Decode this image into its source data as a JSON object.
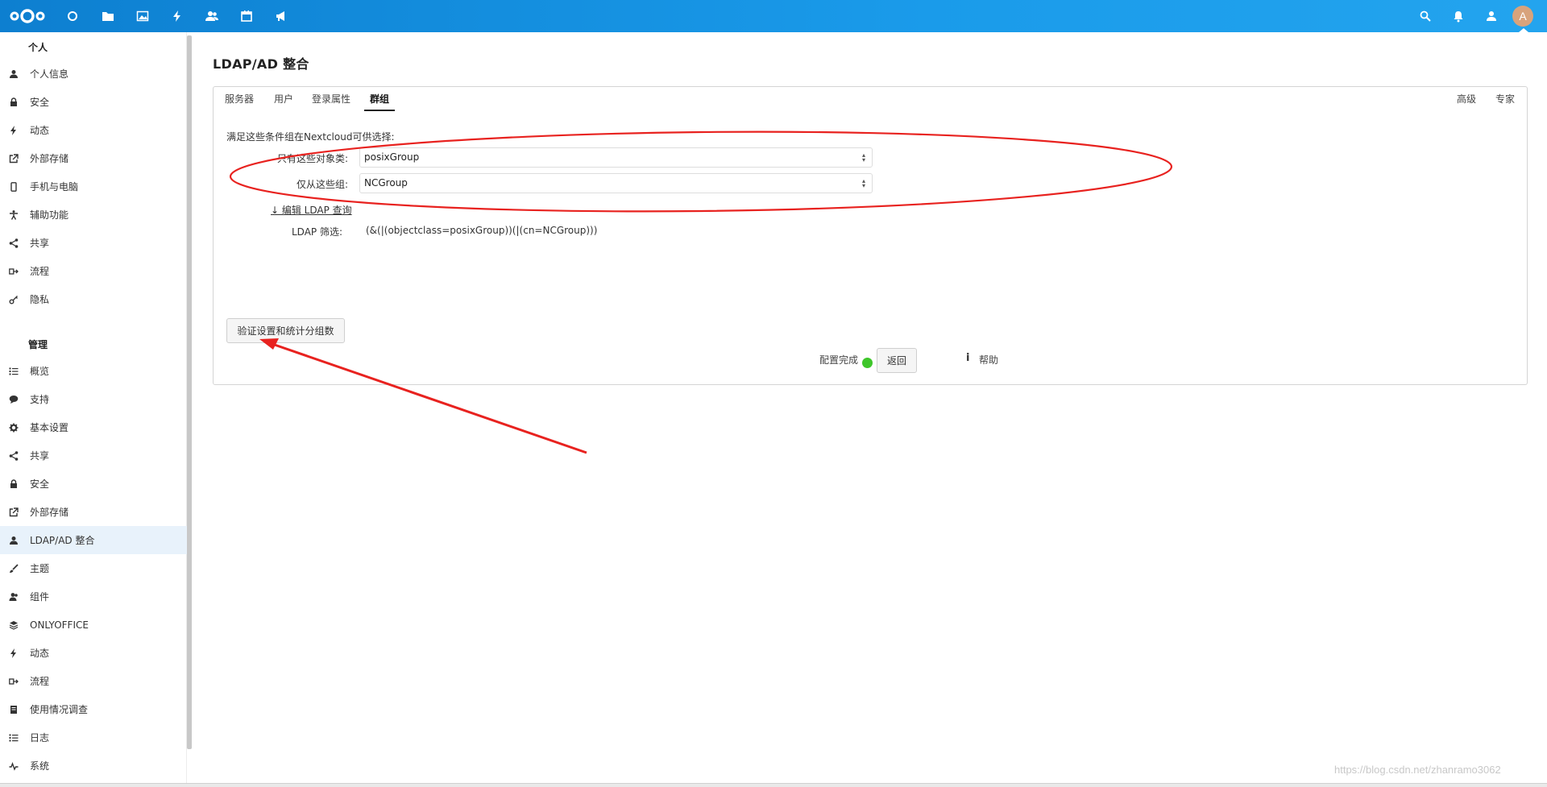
{
  "header": {
    "apps": [
      {
        "name": "dashboard-icon"
      },
      {
        "name": "files-icon"
      },
      {
        "name": "photos-icon"
      },
      {
        "name": "activity-icon"
      },
      {
        "name": "contacts-icon"
      },
      {
        "name": "calendar-icon"
      },
      {
        "name": "announcements-icon"
      }
    ],
    "avatar_letter": "A",
    "accent_color": "#1a8fe0"
  },
  "sidebar": {
    "personal_caption": "个人",
    "personal_items": [
      {
        "label": "个人信息",
        "icon": "user-icon"
      },
      {
        "label": "安全",
        "icon": "lock-icon"
      },
      {
        "label": "动态",
        "icon": "lightning-icon"
      },
      {
        "label": "外部存储",
        "icon": "external-link-icon"
      },
      {
        "label": "手机与电脑",
        "icon": "phone-icon"
      },
      {
        "label": "辅助功能",
        "icon": "accessibility-icon"
      },
      {
        "label": "共享",
        "icon": "share-icon"
      },
      {
        "label": "流程",
        "icon": "flow-icon"
      },
      {
        "label": "隐私",
        "icon": "key-icon"
      }
    ],
    "admin_caption": "管理",
    "admin_items": [
      {
        "label": "概览",
        "icon": "list-icon"
      },
      {
        "label": "支持",
        "icon": "speech-bubble-icon"
      },
      {
        "label": "基本设置",
        "icon": "gear-icon"
      },
      {
        "label": "共享",
        "icon": "share-icon"
      },
      {
        "label": "安全",
        "icon": "lock-icon"
      },
      {
        "label": "外部存储",
        "icon": "external-link-icon"
      },
      {
        "label": "LDAP/AD 整合",
        "icon": "user-icon",
        "active": true
      },
      {
        "label": "主题",
        "icon": "paintbrush-icon"
      },
      {
        "label": "组件",
        "icon": "group-icon"
      },
      {
        "label": "ONLYOFFICE",
        "icon": "layers-icon"
      },
      {
        "label": "动态",
        "icon": "lightning-icon"
      },
      {
        "label": "流程",
        "icon": "flow-icon"
      },
      {
        "label": "使用情况调查",
        "icon": "survey-icon"
      },
      {
        "label": "日志",
        "icon": "list-icon"
      },
      {
        "label": "系统",
        "icon": "pulse-icon"
      }
    ]
  },
  "main": {
    "title": "LDAP/AD 整合",
    "tabs": [
      "服务器",
      "用户",
      "登录属性",
      "群组"
    ],
    "active_tab": "群组",
    "right_tabs": [
      "高级",
      "专家"
    ],
    "description": "满足这些条件组在Nextcloud可供选择:",
    "object_class_label": "只有这些对象类:",
    "object_class_value": "posixGroup",
    "groups_label": "仅从这些组:",
    "groups_value": "NCGroup",
    "edit_query_link": "↓ 编辑 LDAP 查询",
    "filter_label": "LDAP 筛选:",
    "filter_value": "(&(|(objectclass=posixGroup))(|(cn=NCGroup)))",
    "verify_button": "验证设置和统计分组数",
    "status_text": "配置完成",
    "status_color": "#3ec62a",
    "back_button": "返回",
    "help_label": "帮助"
  },
  "annotation": {
    "color": "#e8221f"
  },
  "watermark": "https://blog.csdn.net/zhanramo3062"
}
